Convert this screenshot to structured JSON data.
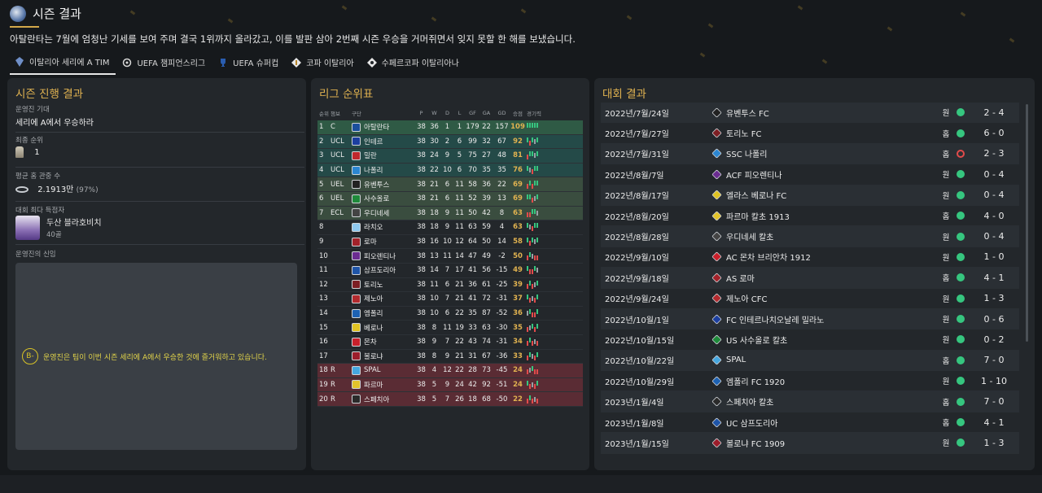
{
  "header": {
    "title": "시즌 결과",
    "subtitle": "아탈란타는 7월에 엄청난 기세를 보여 주며 결국 1위까지 올라갔고, 이를 발판 삼아 2번째 시즌 우승을 거머쥐면서 잊지 못할 한 해를 보냈습니다."
  },
  "tabs": [
    {
      "label": "이탈리아 세리에 A TIM",
      "icon": "serie-a-logo-icon",
      "active": true
    },
    {
      "label": "UEFA 챔피언스리그",
      "icon": "champions-league-icon"
    },
    {
      "label": "UEFA 슈퍼컵",
      "icon": "super-cup-icon"
    },
    {
      "label": "코파 이탈리아",
      "icon": "coppa-italia-icon"
    },
    {
      "label": "수페르코파 이탈리아나",
      "icon": "supercoppa-icon"
    }
  ],
  "season": {
    "title": "시즌 진행 결과",
    "expectation_label": "운영진 기대",
    "expectation_value": "세리에 A에서 우승하라",
    "final_rank_label": "최종 순위",
    "final_rank_value": "1",
    "attendance_label": "평균 홈 관중 수",
    "attendance_value": "2.1913만",
    "attendance_pct": "(97%)",
    "top_scorer_label": "대회 최다 득점자",
    "top_scorer_name": "두산 블라호비치",
    "top_scorer_goals": "40골",
    "trust_label": "운영진의 신임",
    "message_icon": "B-",
    "message": "운영진은 팀이 이번 시즌 세리에 A에서 우승한 것에 즐거워하고 있습니다."
  },
  "standings": {
    "title": "리그 순위표",
    "headers": [
      "순위",
      "챔보",
      "구단",
      "P",
      "W",
      "D",
      "L",
      "GF",
      "GA",
      "GD",
      "승점",
      "경기력"
    ],
    "rows": [
      {
        "pos": "1",
        "q": "C",
        "team": "아탈란타",
        "p": "38",
        "w": "36",
        "d": "1",
        "l": "1",
        "gf": "179",
        "ga": "22",
        "gd": "157",
        "pts": "109",
        "cls": "c",
        "color": "#1b4f9c",
        "form": "WWWWW"
      },
      {
        "pos": "2",
        "q": "UCL",
        "team": "인테르",
        "p": "38",
        "w": "30",
        "d": "2",
        "l": "6",
        "gf": "99",
        "ga": "32",
        "gd": "67",
        "pts": "92",
        "cls": "q",
        "color": "#1c3fa0",
        "form": "WLWDW"
      },
      {
        "pos": "3",
        "q": "UCL",
        "team": "밀란",
        "p": "38",
        "w": "24",
        "d": "9",
        "l": "5",
        "gf": "75",
        "ga": "27",
        "gd": "48",
        "pts": "81",
        "cls": "q",
        "color": "#c0282d",
        "form": "LWWDW"
      },
      {
        "pos": "4",
        "q": "UCL",
        "team": "나폴리",
        "p": "38",
        "w": "22",
        "d": "10",
        "l": "6",
        "gf": "70",
        "ga": "35",
        "gd": "35",
        "pts": "76",
        "cls": "q",
        "color": "#2b86d1",
        "form": "WDLWW"
      },
      {
        "pos": "5",
        "q": "UEL",
        "team": "유벤투스",
        "p": "38",
        "w": "21",
        "d": "6",
        "l": "11",
        "gf": "58",
        "ga": "36",
        "gd": "22",
        "pts": "69",
        "cls": "e",
        "color": "#222222",
        "form": "LWLWW"
      },
      {
        "pos": "6",
        "q": "UEL",
        "team": "사수올로",
        "p": "38",
        "w": "21",
        "d": "6",
        "l": "11",
        "gf": "52",
        "ga": "39",
        "gd": "13",
        "pts": "69",
        "cls": "e",
        "color": "#1e8a3a",
        "form": "WWLDW"
      },
      {
        "pos": "7",
        "q": "ECL",
        "team": "우디네세",
        "p": "38",
        "w": "18",
        "d": "9",
        "l": "11",
        "gf": "50",
        "ga": "42",
        "gd": "8",
        "pts": "63",
        "cls": "e",
        "color": "#444444",
        "form": "LLWWD"
      },
      {
        "pos": "8",
        "q": "",
        "team": "라치오",
        "p": "38",
        "w": "18",
        "d": "9",
        "l": "11",
        "gf": "63",
        "ga": "59",
        "gd": "4",
        "pts": "63",
        "cls": "",
        "color": "#8ec8ef",
        "form": "WDLWW"
      },
      {
        "pos": "9",
        "q": "",
        "team": "로마",
        "p": "38",
        "w": "16",
        "d": "10",
        "l": "12",
        "gf": "64",
        "ga": "50",
        "gd": "14",
        "pts": "58",
        "cls": "",
        "color": "#a3222a",
        "form": "WLWDW"
      },
      {
        "pos": "10",
        "q": "",
        "team": "피오렌티나",
        "p": "38",
        "w": "13",
        "d": "11",
        "l": "14",
        "gf": "47",
        "ga": "49",
        "gd": "-2",
        "pts": "50",
        "cls": "",
        "color": "#6b2c91",
        "form": "LWDLL"
      },
      {
        "pos": "11",
        "q": "",
        "team": "삼프도리아",
        "p": "38",
        "w": "14",
        "d": "7",
        "l": "17",
        "gf": "41",
        "ga": "56",
        "gd": "-15",
        "pts": "49",
        "cls": "",
        "color": "#1f55a8",
        "form": "WLLWD"
      },
      {
        "pos": "12",
        "q": "",
        "team": "토리노",
        "p": "38",
        "w": "11",
        "d": "6",
        "l": "21",
        "gf": "36",
        "ga": "61",
        "gd": "-25",
        "pts": "39",
        "cls": "",
        "color": "#7d1f24",
        "form": "LWLDW"
      },
      {
        "pos": "13",
        "q": "",
        "team": "제노아",
        "p": "38",
        "w": "10",
        "d": "7",
        "l": "21",
        "gf": "41",
        "ga": "72",
        "gd": "-31",
        "pts": "37",
        "cls": "",
        "color": "#b22a2e",
        "form": "WLDLW"
      },
      {
        "pos": "14",
        "q": "",
        "team": "엠폴리",
        "p": "38",
        "w": "10",
        "d": "6",
        "l": "22",
        "gf": "35",
        "ga": "87",
        "gd": "-52",
        "pts": "36",
        "cls": "",
        "color": "#1d62b3",
        "form": "DWLLW"
      },
      {
        "pos": "15",
        "q": "",
        "team": "베로나",
        "p": "38",
        "w": "8",
        "d": "11",
        "l": "19",
        "gf": "33",
        "ga": "63",
        "gd": "-30",
        "pts": "35",
        "cls": "",
        "color": "#e0c323",
        "form": "LDWLW"
      },
      {
        "pos": "16",
        "q": "",
        "team": "몬차",
        "p": "38",
        "w": "9",
        "d": "7",
        "l": "22",
        "gf": "43",
        "ga": "74",
        "gd": "-31",
        "pts": "34",
        "cls": "",
        "color": "#c8202b",
        "form": "LWLDL"
      },
      {
        "pos": "17",
        "q": "",
        "team": "볼로냐",
        "p": "38",
        "w": "8",
        "d": "9",
        "l": "21",
        "gf": "31",
        "ga": "67",
        "gd": "-36",
        "pts": "33",
        "cls": "",
        "color": "#9c1d2b",
        "form": "LWDLW"
      },
      {
        "pos": "18",
        "q": "R",
        "team": "SPAL",
        "p": "38",
        "w": "4",
        "d": "12",
        "l": "22",
        "gf": "28",
        "ga": "73",
        "gd": "-45",
        "pts": "24",
        "cls": "r",
        "color": "#45a7e0",
        "form": "LDWLL"
      },
      {
        "pos": "19",
        "q": "R",
        "team": "파르마",
        "p": "38",
        "w": "5",
        "d": "9",
        "l": "24",
        "gf": "42",
        "ga": "92",
        "gd": "-51",
        "pts": "24",
        "cls": "r",
        "color": "#e3c42b",
        "form": "WLDLW"
      },
      {
        "pos": "20",
        "q": "R",
        "team": "스페치아",
        "p": "38",
        "w": "5",
        "d": "7",
        "l": "26",
        "gf": "18",
        "ga": "68",
        "gd": "-50",
        "pts": "22",
        "cls": "r",
        "color": "#2a2a2a",
        "form": "LWLDL"
      }
    ]
  },
  "results": {
    "title": "대회 결과",
    "rows": [
      {
        "date": "2022년/7월/24일",
        "team": "유벤투스 FC",
        "ha": "원",
        "res": "win",
        "score": "2 - 4",
        "color": "#222222"
      },
      {
        "date": "2022년/7월/27일",
        "team": "토리노 FC",
        "ha": "홈",
        "res": "win",
        "score": "6 - 0",
        "color": "#7d1f24"
      },
      {
        "date": "2022년/7월/31일",
        "team": "SSC 나폴리",
        "ha": "홈",
        "res": "loss",
        "score": "2 - 3",
        "color": "#2b86d1"
      },
      {
        "date": "2022년/8월/7일",
        "team": "ACF 피오렌티나",
        "ha": "원",
        "res": "win",
        "score": "0 - 4",
        "color": "#6b2c91"
      },
      {
        "date": "2022년/8월/17일",
        "team": "엘라스 베로나 FC",
        "ha": "원",
        "res": "win",
        "score": "0 - 4",
        "color": "#e0c323"
      },
      {
        "date": "2022년/8월/20일",
        "team": "파르마 칼초 1913",
        "ha": "홈",
        "res": "win",
        "score": "4 - 0",
        "color": "#e3c42b"
      },
      {
        "date": "2022년/8월/28일",
        "team": "우디네세 칼초",
        "ha": "원",
        "res": "win",
        "score": "0 - 4",
        "color": "#444444"
      },
      {
        "date": "2022년/9월/10일",
        "team": "AC 몬차 브리안차 1912",
        "ha": "원",
        "res": "win",
        "score": "1 - 0",
        "color": "#c8202b"
      },
      {
        "date": "2022년/9월/18일",
        "team": "AS 로마",
        "ha": "홈",
        "res": "win",
        "score": "4 - 1",
        "color": "#a3222a"
      },
      {
        "date": "2022년/9월/24일",
        "team": "제노아 CFC",
        "ha": "원",
        "res": "win",
        "score": "1 - 3",
        "color": "#b22a2e"
      },
      {
        "date": "2022년/10월/1일",
        "team": "FC 인테르나치오날레 밀라노",
        "ha": "원",
        "res": "win",
        "score": "0 - 6",
        "color": "#1c3fa0"
      },
      {
        "date": "2022년/10월/15일",
        "team": "US 사수올로 칼초",
        "ha": "원",
        "res": "win",
        "score": "0 - 2",
        "color": "#1e8a3a"
      },
      {
        "date": "2022년/10월/22일",
        "team": "SPAL",
        "ha": "홈",
        "res": "win",
        "score": "7 - 0",
        "color": "#45a7e0"
      },
      {
        "date": "2022년/10월/29일",
        "team": "엠폴리 FC 1920",
        "ha": "원",
        "res": "win",
        "score": "1 - 10",
        "color": "#1d62b3"
      },
      {
        "date": "2023년/1월/4일",
        "team": "스페치아 칼초",
        "ha": "홈",
        "res": "win",
        "score": "7 - 0",
        "color": "#2a2a2a"
      },
      {
        "date": "2023년/1월/8일",
        "team": "UC 삼프도리아",
        "ha": "홈",
        "res": "win",
        "score": "4 - 1",
        "color": "#1f55a8"
      },
      {
        "date": "2023년/1월/15일",
        "team": "볼로냐 FC 1909",
        "ha": "원",
        "res": "win",
        "score": "1 - 3",
        "color": "#9c1d2b"
      }
    ]
  }
}
